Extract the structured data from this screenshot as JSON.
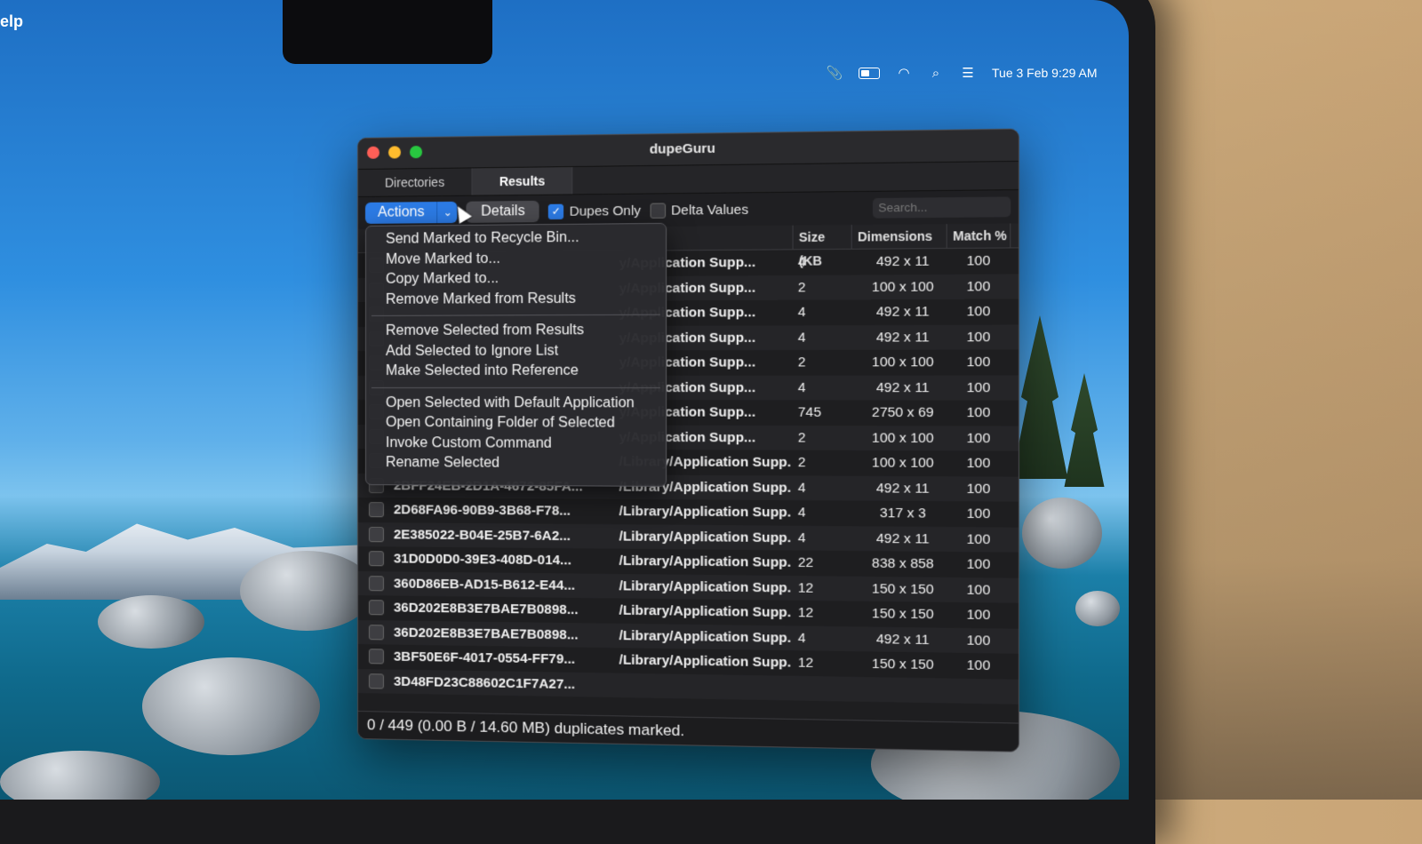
{
  "menubar": {
    "help_fragment": "elp",
    "datetime": "Tue 3 Feb  9:29 AM",
    "icons": [
      "paperclip-icon",
      "battery-icon",
      "wifi-icon",
      "search-icon",
      "control-center-icon"
    ]
  },
  "window": {
    "title": "dupeGuru",
    "tabs": [
      {
        "label": "Directories"
      },
      {
        "label": "Results"
      }
    ],
    "toolbar": {
      "actions_label": "Actions",
      "details_label": "Details",
      "dupes_only_label": "Dupes Only",
      "dupes_only_checked": true,
      "delta_values_label": "Delta Values",
      "delta_values_checked": false,
      "search_placeholder": "Search..."
    },
    "columns": {
      "size": "Size (KB",
      "dimensions": "Dimensions",
      "match": "Match %"
    },
    "rows": [
      {
        "name": "",
        "path": "y/Application Supp...",
        "size": "4",
        "dim": "492 x 11",
        "match": "100"
      },
      {
        "name": "",
        "path": "y/Application Supp...",
        "size": "2",
        "dim": "100 x 100",
        "match": "100"
      },
      {
        "name": "",
        "path": "y/Application Supp...",
        "size": "4",
        "dim": "492 x 11",
        "match": "100"
      },
      {
        "name": "",
        "path": "y/Application Supp...",
        "size": "4",
        "dim": "492 x 11",
        "match": "100"
      },
      {
        "name": "",
        "path": "y/Application Supp...",
        "size": "2",
        "dim": "100 x 100",
        "match": "100"
      },
      {
        "name": "",
        "path": "y/Application Supp...",
        "size": "4",
        "dim": "492 x 11",
        "match": "100"
      },
      {
        "name": "",
        "path": "y/Application Supp...",
        "size": "745",
        "dim": "2750 x 69",
        "match": "100"
      },
      {
        "name": "",
        "path": "y/Application Supp...",
        "size": "2",
        "dim": "100 x 100",
        "match": "100"
      },
      {
        "name": "",
        "path": "/Library/Application Supp...",
        "size": "2",
        "dim": "100 x 100",
        "match": "100"
      },
      {
        "name": "2BFF24EB-2D1A-4672-85FA...",
        "path": "/Library/Application Supp...",
        "size": "4",
        "dim": "492 x 11",
        "match": "100"
      },
      {
        "name": "2D68FA96-90B9-3B68-F78...",
        "path": "/Library/Application Supp...",
        "size": "4",
        "dim": "317 x 3",
        "match": "100"
      },
      {
        "name": "2E385022-B04E-25B7-6A2...",
        "path": "/Library/Application Supp...",
        "size": "4",
        "dim": "492 x 11",
        "match": "100"
      },
      {
        "name": "31D0D0D0-39E3-408D-014...",
        "path": "/Library/Application Supp...",
        "size": "22",
        "dim": "838 x 858",
        "match": "100"
      },
      {
        "name": "360D86EB-AD15-B612-E44...",
        "path": "/Library/Application Supp...",
        "size": "12",
        "dim": "150 x 150",
        "match": "100"
      },
      {
        "name": "36D202E8B3E7BAE7B0898...",
        "path": "/Library/Application Supp...",
        "size": "12",
        "dim": "150 x 150",
        "match": "100"
      },
      {
        "name": "36D202E8B3E7BAE7B0898...",
        "path": "/Library/Application Supp...",
        "size": "4",
        "dim": "492 x 11",
        "match": "100"
      },
      {
        "name": "3BF50E6F-4017-0554-FF79...",
        "path": "/Library/Application Supp...",
        "size": "12",
        "dim": "150 x 150",
        "match": "100"
      },
      {
        "name": "3D48FD23C88602C1F7A27...",
        "path": "",
        "size": "",
        "dim": "",
        "match": ""
      }
    ],
    "status": "0 / 449 (0.00 B / 14.60 MB) duplicates marked.",
    "menu": {
      "group1": [
        "Send Marked to Recycle Bin...",
        "Move Marked to...",
        "Copy Marked to...",
        "Remove Marked from Results"
      ],
      "group2": [
        "Remove Selected from Results",
        "Add Selected to Ignore List",
        "Make Selected into Reference"
      ],
      "group3": [
        "Open Selected with Default Application",
        "Open Containing Folder of Selected",
        "Invoke Custom Command",
        "Rename Selected"
      ]
    }
  },
  "colors": {
    "accent": "#2c7be5",
    "close": "#ff5f57",
    "minimize": "#febc2e",
    "zoom": "#28c840"
  }
}
